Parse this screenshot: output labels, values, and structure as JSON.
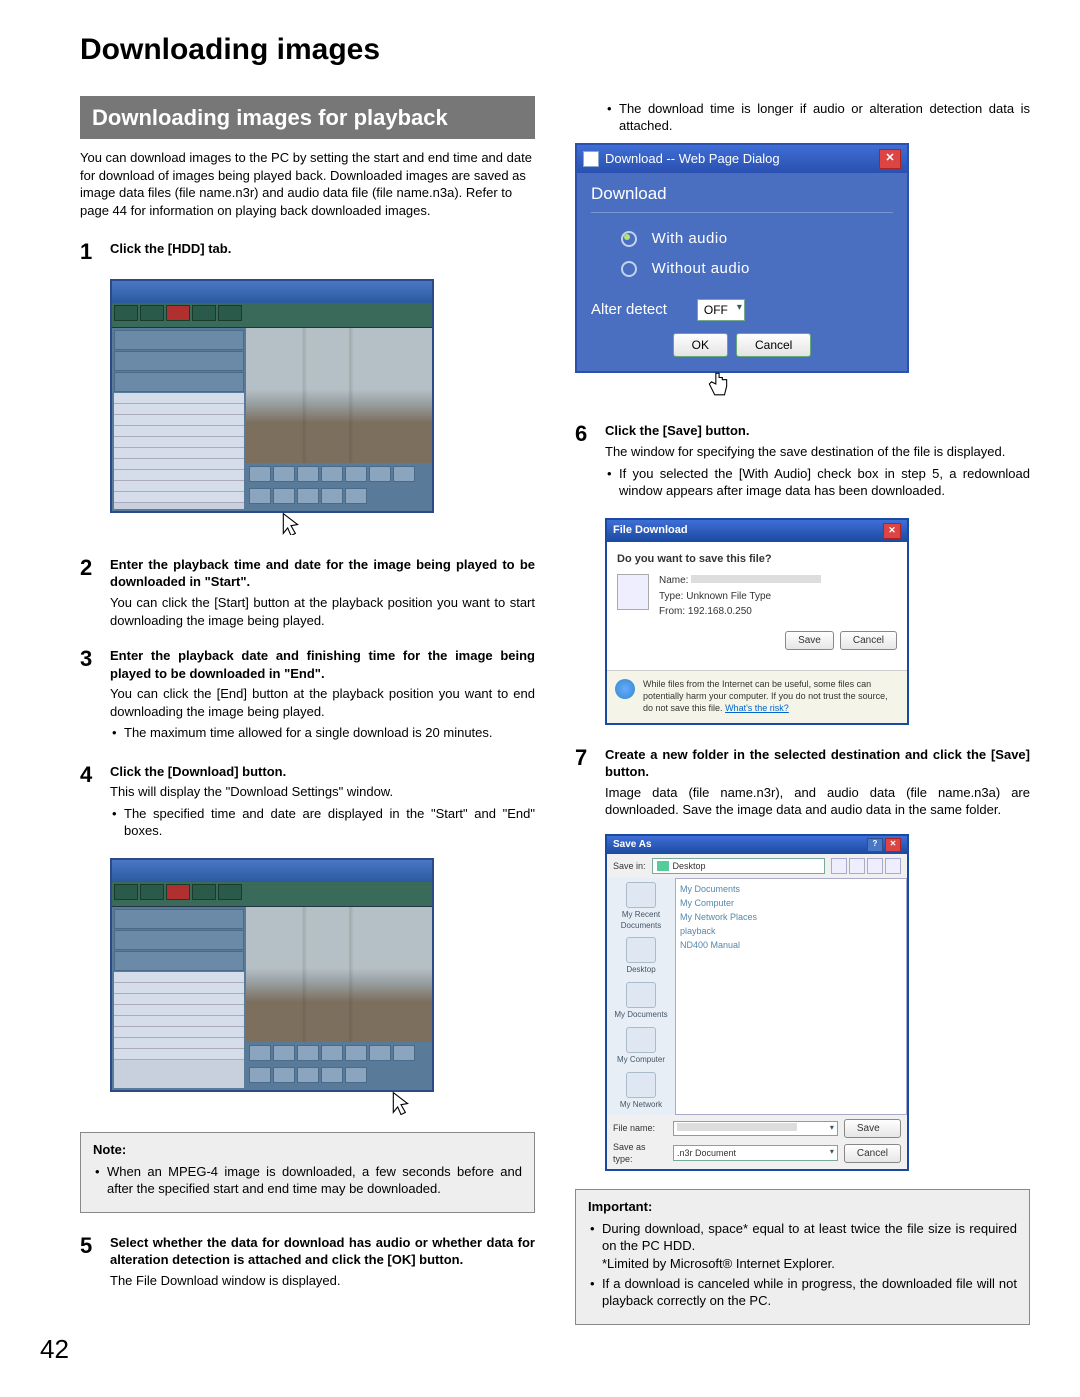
{
  "pageTitle": "Downloading images",
  "sectionHeader": "Downloading images for playback",
  "intro": "You can download images to the PC by setting the start and end time and date for download of images being played back. Downloaded images are saved as image data files (file name.n3r) and audio data file (file name.n3a). Refer to page 44 for information on playing back downloaded images.",
  "steps": {
    "s1": {
      "num": "1",
      "title": "Click the [HDD] tab."
    },
    "s2": {
      "num": "2",
      "title": "Enter the playback time and date for the image being played to be downloaded in \"Start\".",
      "text": "You can click the [Start] button at the playback position you want to start downloading the image being played."
    },
    "s3": {
      "num": "3",
      "title": "Enter the playback date and finishing time for the image being played to be downloaded in \"End\".",
      "text": "You can click the [End] button at the playback position you want to end downloading the image being played.",
      "bullet": "The maximum time allowed for a single download is 20 minutes."
    },
    "s4": {
      "num": "4",
      "title": "Click the [Download] button.",
      "text": "This will display the \"Download Settings\" window.",
      "bullet": "The specified time and date are displayed in the \"Start\" and \"End\" boxes."
    },
    "s5": {
      "num": "5",
      "title": "Select whether the data for download has audio or whether data for alteration detection is attached and click the [OK] button.",
      "text": "The File Download window is displayed.",
      "bullet": "The download time is longer if audio or alteration detection data is attached."
    },
    "s6": {
      "num": "6",
      "title": "Click the [Save] button.",
      "text": "The window for specifying the save destination of the file is displayed.",
      "bullet": "If you selected the [With Audio] check box in step 5, a redownload window appears after image data has been downloaded."
    },
    "s7": {
      "num": "7",
      "title": "Create a new folder in the selected destination and click the [Save] button.",
      "text": "Image data (file name.n3r), and audio data (file name.n3a) are downloaded. Save the image data and audio data in the same folder."
    }
  },
  "noteBox": {
    "title": "Note:",
    "bullet": "When an MPEG-4 image is downloaded, a few seconds before and after the specified start and end time may be downloaded."
  },
  "importantBox": {
    "title": "Important:",
    "b1": "During download, space* equal to at least twice the file size is required on the PC HDD.",
    "b1sub": "*Limited by Microsoft® Internet Explorer.",
    "b2": "If a download is canceled while in progress, the downloaded file will not playback correctly on the PC."
  },
  "dlDialog": {
    "title": "Download -- Web Page Dialog",
    "heading": "Download",
    "withAudio": "With audio",
    "withoutAudio": "Without audio",
    "alter": "Alter detect",
    "alterValue": "OFF",
    "ok": "OK",
    "cancel": "Cancel"
  },
  "fileDownload": {
    "title": "File Download",
    "question": "Do you want to save this file?",
    "nameLabel": "Name:",
    "typeLabel": "Type:",
    "typeValue": "Unknown File Type",
    "fromLabel": "From:",
    "fromValue": "192.168.0.250",
    "save": "Save",
    "cancel": "Cancel",
    "warn": "While files from the Internet can be useful, some files can potentially harm your computer. If you do not trust the source, do not save this file.",
    "warnLink": "What's the risk?"
  },
  "saveAs": {
    "title": "Save As",
    "saveInLabel": "Save in:",
    "saveInValue": "Desktop",
    "places": {
      "recent": "My Recent Documents",
      "desktop": "Desktop",
      "mydocs": "My Documents",
      "mycomp": "My Computer",
      "mynet": "My Network"
    },
    "items": [
      "My Documents",
      "My Computer",
      "My Network Places",
      "playback",
      "ND400 Manual"
    ],
    "fileNameLabel": "File name:",
    "saveTypeLabel": "Save as type:",
    "saveTypeValue": ".n3r Document",
    "save": "Save",
    "cancel": "Cancel"
  },
  "pageNumber": "42"
}
